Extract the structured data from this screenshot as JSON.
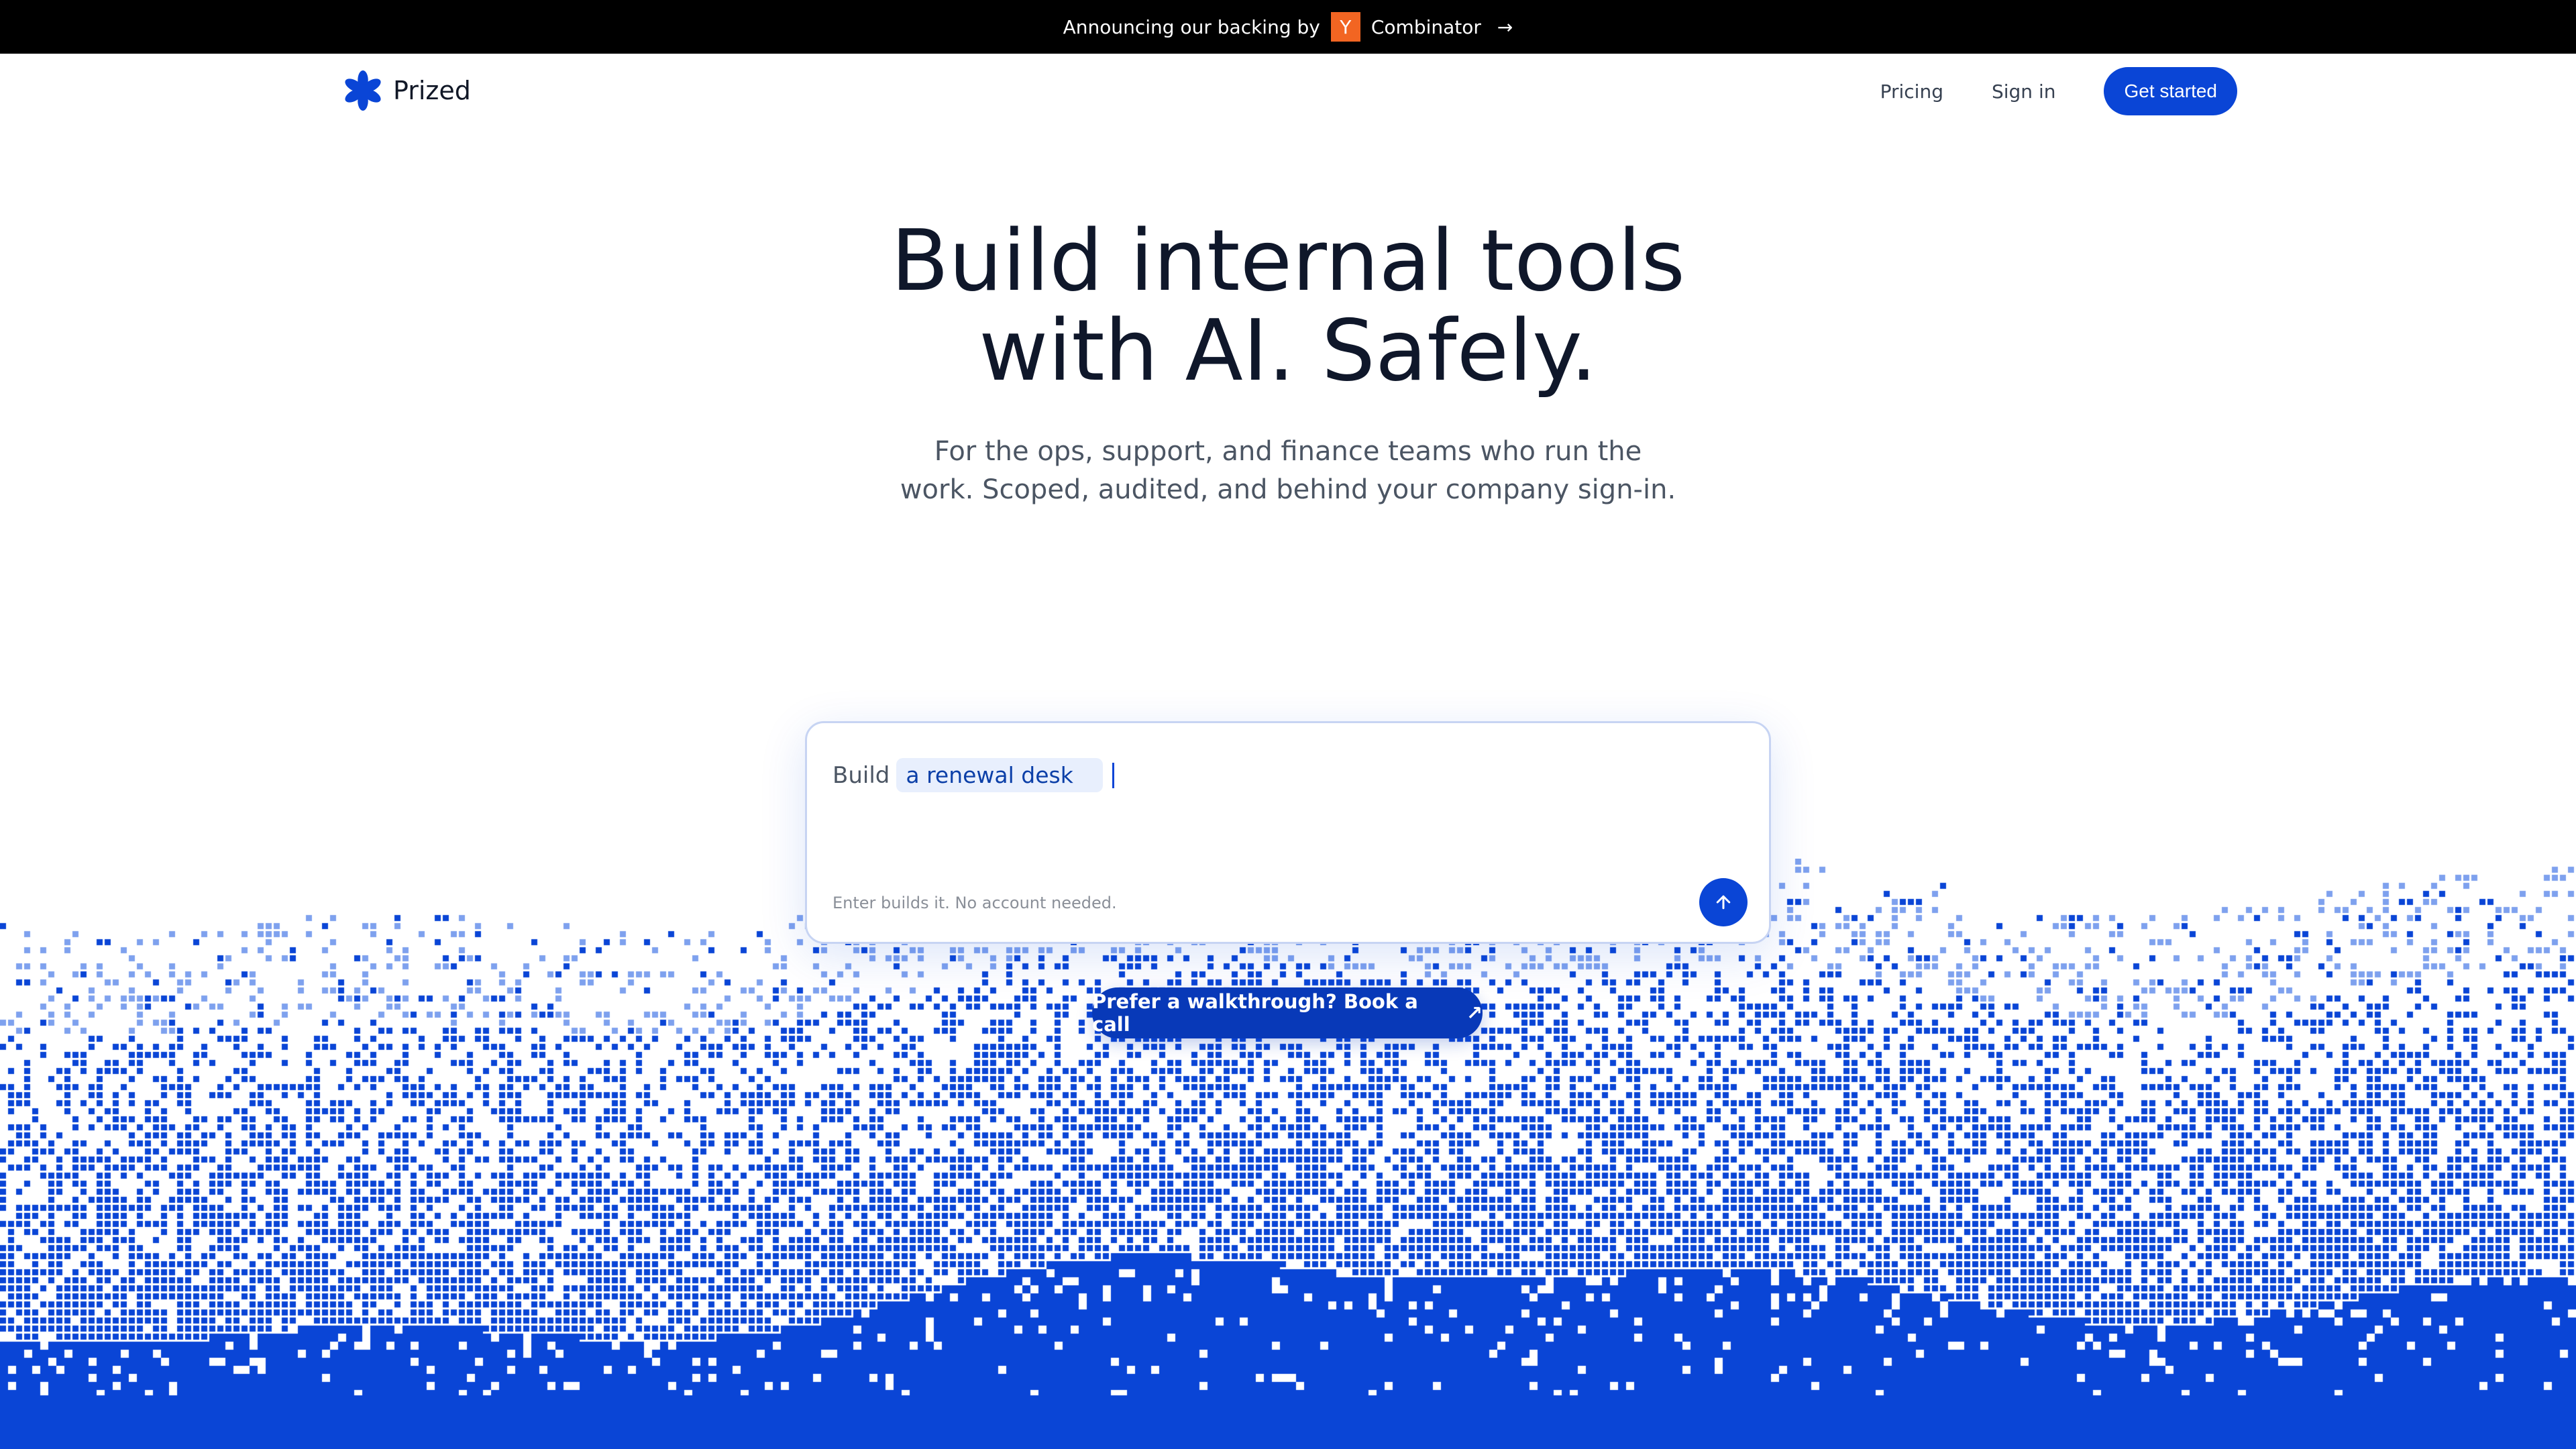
{
  "announcement": {
    "text": "Announcing our backing by",
    "badge": "Y",
    "partner": "Combinator",
    "arrow": "→"
  },
  "nav": {
    "brand": "Prized",
    "links": [
      {
        "label": "Pricing"
      },
      {
        "label": "Sign in"
      }
    ],
    "cta": "Get started"
  },
  "hero": {
    "title_line1": "Build internal tools",
    "title_line2": "with AI. Safely.",
    "subtitle_line1": "For the ops, support, and finance teams who run the",
    "subtitle_line2": "work. Scoped, audited, and behind your company sign-in."
  },
  "prompt": {
    "prefix": "Build",
    "suggestion": "a renewal desk",
    "hint": "Enter builds it. No account needed."
  },
  "walkthrough": {
    "label": "Prefer a walkthrough? Book a call",
    "icon": "↗"
  },
  "colors": {
    "brand": "#0a45d6",
    "brand_dark": "#0839b8",
    "ink": "#0f172a",
    "badge": "#f26522",
    "pixel_light": "#7ea1ee",
    "pixel_dark": "#0a45d6"
  }
}
